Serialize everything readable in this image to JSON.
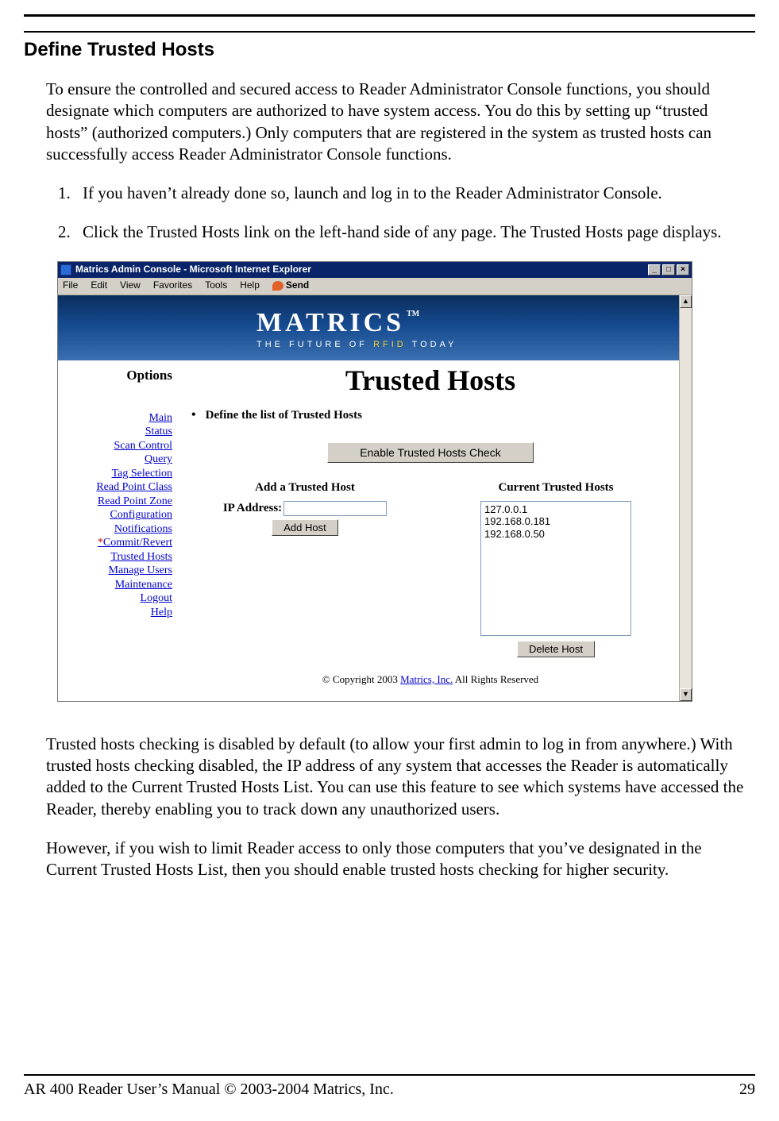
{
  "section_title": "Define Trusted Hosts",
  "intro": "To ensure the controlled and secured access to Reader Administrator Console functions, you should designate which computers are authorized to have system access. You do this by setting up “trusted hosts” (authorized computers.) Only computers that are registered in the system as trusted hosts can successfully access Reader Administrator Console functions.",
  "steps": {
    "one": "If you haven’t already done so, launch and log in to the Reader Administrator Console.",
    "two": "Click the Trusted Hosts link on the left-hand side of any page. The Trusted Hosts page displays."
  },
  "browser": {
    "title": "Matrics Admin Console - Microsoft Internet Explorer",
    "menu": {
      "file": "File",
      "edit": "Edit",
      "view": "View",
      "fav": "Favorites",
      "tools": "Tools",
      "help": "Help",
      "send": "Send"
    },
    "logo": "MATRICS",
    "logo_tm": "TM",
    "tagline_a": "THE FUTURE OF ",
    "tagline_b": "RFID",
    "tagline_c": " TODAY"
  },
  "sidebar": {
    "title": "Options",
    "items": {
      "main": "Main",
      "status": "Status",
      "scan": "Scan Control",
      "query": "Query",
      "tagsel": "Tag Selection",
      "rpc": "Read Point Class",
      "rpz": "Read Point Zone",
      "config": "Configuration",
      "notif": "Notifications",
      "commit": "Commit/Revert",
      "trusted": "Trusted Hosts",
      "users": "Manage Users",
      "maint": "Maintenance",
      "logout": "Logout",
      "help": "Help"
    }
  },
  "page": {
    "title": "Trusted Hosts",
    "bullet": "Define the list of Trusted Hosts",
    "enable_btn": "Enable Trusted Hosts Check",
    "add_title": "Add a Trusted Host",
    "ip_label": "IP Address:",
    "add_btn": "Add Host",
    "current_title": "Current Trusted Hosts",
    "hosts": {
      "h1": "127.0.0.1",
      "h2": "192.168.0.181",
      "h3": "192.168.0.50"
    },
    "delete_btn": "Delete Host",
    "copyright_a": "© Copyright 2003 ",
    "copyright_link": "Matrics, Inc.",
    "copyright_b": "  All Rights Reserved"
  },
  "outro1": "Trusted hosts checking is disabled by default (to allow your first admin to log in from anywhere.) With trusted hosts checking disabled, the IP address of any system that accesses the Reader is automatically added to the Current Trusted Hosts List. You can use this feature to see which systems have accessed the Reader, thereby enabling you to track down any unauthorized users.",
  "outro2": "However, if you wish to limit Reader access to only those computers that you’ve designated in the Current Trusted Hosts List, then you should enable trusted hosts checking for higher security.",
  "footer": {
    "left": "AR 400 Reader User’s Manual © 2003-2004 Matrics, Inc.",
    "right": "29"
  }
}
